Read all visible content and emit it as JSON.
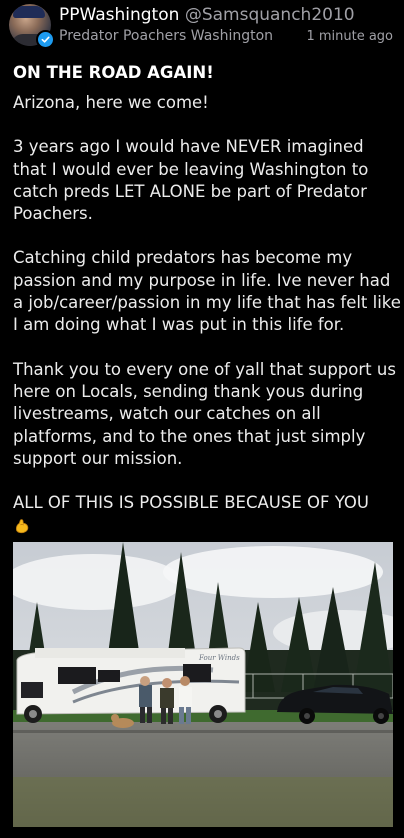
{
  "post": {
    "author": {
      "display_name": "PPWashington",
      "handle": "@Samsquanch2010",
      "verified": true,
      "avatar_icon": "user-avatar"
    },
    "community": "Predator Poachers Washington",
    "timestamp": "1 minute ago",
    "title": "ON THE ROAD AGAIN!",
    "paragraphs": [
      "Arizona, here we come!",
      "3 years ago I would have NEVER imagined that I would ever be leaving Washington to catch preds LET ALONE be part of Predator Poachers.",
      "Catching child predators has become my passion and my purpose in life. Ive never had a job/career/passion in my life that has felt like I am doing what I was put in this life for.",
      "Thank you to every one of yall that support us here on Locals, sending thank yous during livestreams, watch our catches on all platforms, and to the ones that just simply support our mission.",
      "ALL OF THIS IS POSSIBLE BECAUSE OF YOU"
    ],
    "closing_emoji_icon": "flexed-biceps-emoji",
    "photo": {
      "motorhome_text": "Four Winds"
    }
  },
  "colors": {
    "background": "#000000",
    "text_primary": "#ffffff",
    "text_secondary": "#a0a0a6",
    "verified_badge": "#1d9bf0"
  }
}
